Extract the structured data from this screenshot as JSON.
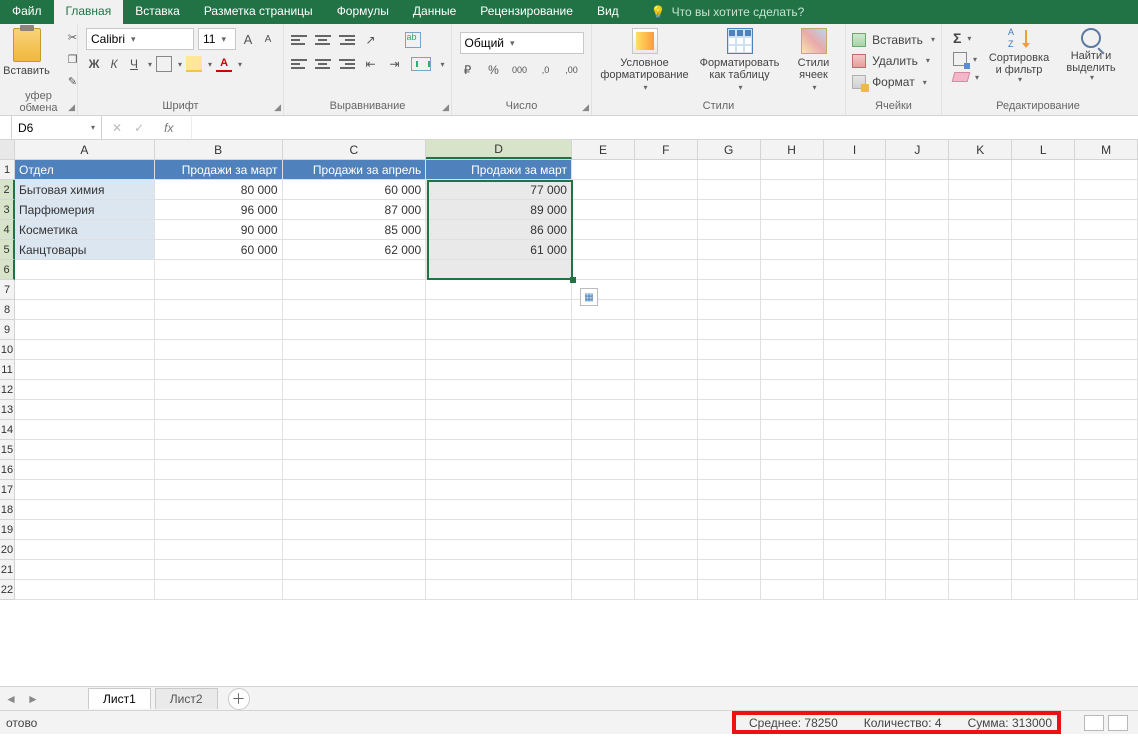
{
  "tabs": {
    "file": "Файл",
    "home": "Главная",
    "insert": "Вставка",
    "page_layout": "Разметка страницы",
    "formulas": "Формулы",
    "data": "Данные",
    "review": "Рецензирование",
    "view": "Вид",
    "tell_me": "Что вы хотите сделать?"
  },
  "ribbon": {
    "clipboard": {
      "label": "уфер обмена",
      "paste": "Вставить"
    },
    "font": {
      "label": "Шрифт",
      "name": "Calibri",
      "size": "11",
      "grow": "A",
      "shrink": "A",
      "bold": "Ж",
      "italic": "К",
      "underline": "Ч",
      "fontcolor": "A"
    },
    "alignment": {
      "label": "Выравнивание"
    },
    "number": {
      "label": "Число",
      "format": "Общий",
      "pct": "%",
      "comma": "000",
      "dec_inc": ",0",
      "dec_dec": ",00"
    },
    "styles": {
      "label": "Стили",
      "conditional": "Условное форматирование",
      "as_table": "Форматировать как таблицу",
      "cell_styles": "Стили ячеек"
    },
    "cells": {
      "label": "Ячейки",
      "insert": "Вставить",
      "delete": "Удалить",
      "format": "Формат"
    },
    "editing": {
      "label": "Редактирование",
      "sort_filter": "Сортировка и фильтр",
      "find_select": "Найти и выделить"
    }
  },
  "namebox": "D6",
  "fx": "fx",
  "columns": [
    "A",
    "B",
    "C",
    "D",
    "E",
    "F",
    "G",
    "H",
    "I",
    "J",
    "K",
    "L",
    "M"
  ],
  "table": {
    "headers": [
      "Отдел",
      "Продажи за март",
      "Продажи за апрель",
      "Продажи за март"
    ],
    "rows": [
      [
        "Бытовая химия",
        "80 000",
        "60 000",
        "77 000"
      ],
      [
        "Парфюмерия",
        "96 000",
        "87 000",
        "89 000"
      ],
      [
        "Косметика",
        "90 000",
        "85 000",
        "86 000"
      ],
      [
        "Канцтовары",
        "60 000",
        "62 000",
        "61 000"
      ]
    ]
  },
  "sheets": {
    "s1": "Лист1",
    "s2": "Лист2"
  },
  "status": {
    "ready": "отово",
    "avg": "Среднее: 78250",
    "count": "Количество: 4",
    "sum": "Сумма: 313000"
  }
}
